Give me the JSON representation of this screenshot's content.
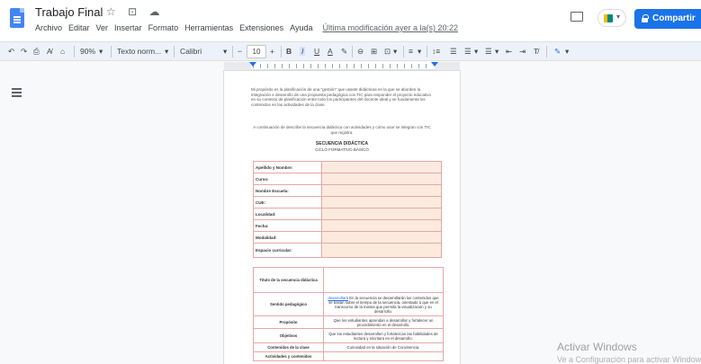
{
  "title_bar": {
    "doc_title": "Trabajo Final",
    "title_icons": "☆ ⊡ ☁",
    "menu": [
      "Archivo",
      "Editar",
      "Ver",
      "Insertar",
      "Formato",
      "Herramientas",
      "Extensiones",
      "Ayuda"
    ],
    "last_edit": "Última modificación ayer a la(s) 20:22",
    "share_label": "Compartir"
  },
  "toolbar": {
    "undo": "↶",
    "redo": "↷",
    "print": "⎙",
    "spellcheck": "A̸",
    "paint_format": "⌂",
    "zoom": "90%",
    "style": "Texto norm...",
    "font": "Calibri",
    "minus": "−",
    "font_size": "10",
    "plus": "+",
    "bold": "B",
    "italic": "I",
    "underline": "U",
    "text_color": "A",
    "highlight": "✎",
    "link": "⊖",
    "comment": "⊞",
    "image": "⊡",
    "align": "≡",
    "line_spacing": "↕≡",
    "checklist": "☰",
    "bullets": "☰",
    "numbered": "☰",
    "indent_less": "⇤",
    "indent_more": "⇥",
    "clear_format": "T̸",
    "editing": "✎"
  },
  "document": {
    "intro": "Mi propósito es la planificación de una \"gestión\" que usaste didácticas en la que se aborden la integración e desarrollo de una propuesta pedagógica con TIC para responder el proyecto educativo en su contexto de planificación entre todo los participantes del docente ideal y se fundamenta los contenidos en las actividades de la clase.",
    "intro2": "A continuación de describe la secuencia didáctica con actividades y cómo usar se integran con TIC que registra.",
    "seq_title": "SECUENCIA DIDÁCTICA",
    "seq_subtitle": "CICLO FORMATIVO BÁSICO",
    "table1": [
      {
        "label": "Apellido y Nombre:",
        "value": ""
      },
      {
        "label": "Curso:",
        "value": ""
      },
      {
        "label": "Nombre Escuela:",
        "value": ""
      },
      {
        "label": "CUE:",
        "value": ""
      },
      {
        "label": "Localidad:",
        "value": ""
      },
      {
        "label": "Fecha:",
        "value": ""
      },
      {
        "label": "Modalidad:",
        "value": ""
      },
      {
        "label": "Espacio curricular:",
        "value": ""
      }
    ],
    "table2": [
      {
        "label": "Título de la secuencia didáctica",
        "value": ""
      },
      {
        "label": "Sentido pedagógico",
        "value": "En la secuencia se desarrollarán los contenidos que se basan sobre el tiempo de la secuencia, orientado a que en el transcurso de la misma que permita la visualización y su desarrollo.",
        "link_word": "desarrollará"
      },
      {
        "label": "Propósito",
        "value": "Que los estudiantes aprendan a desarrollar y fortalecer un procedimiento en el desarrollo."
      },
      {
        "label": "Objetivos",
        "value": "Que los estudiantes desarrollen y fortalezcan las habilidades de lectura y escritura en el desarrollo."
      },
      {
        "label": "Contenidos de la clase",
        "value": "Curiosidad en la situación de Convivencia."
      },
      {
        "label": "Actividades y contenidos",
        "value": ""
      }
    ]
  },
  "watermark": {
    "line1": "Activar Windows",
    "line2": "Ve a Configuración para activar Windows."
  },
  "colors": {
    "share_bg": "#1a73e8",
    "table_border": "#e6a7a7",
    "table_fill": "#fdeadf",
    "toolbar_bg": "#edf2fa"
  }
}
